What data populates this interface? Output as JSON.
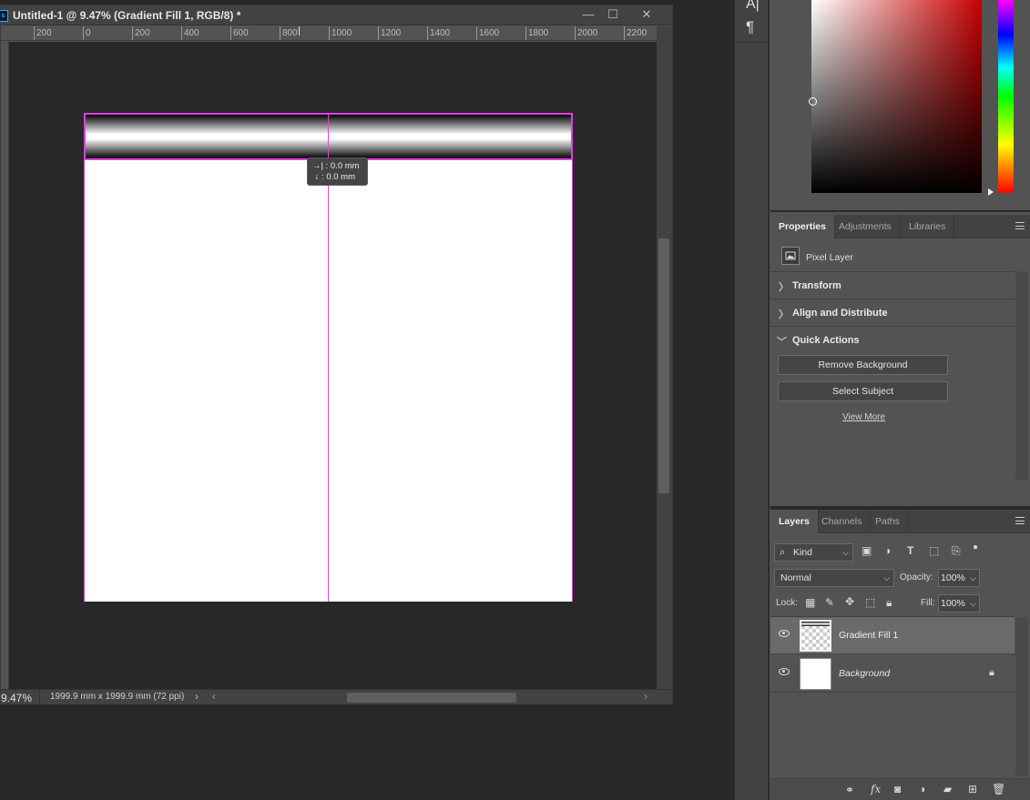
{
  "window": {
    "title": "Untitled-1 @ 9.47% (Gradient Fill 1, RGB/8) *",
    "app_badge": "s",
    "minimize": "—",
    "maximize": "☐",
    "close": "✕"
  },
  "ruler": {
    "top_labels": [
      "200",
      "0",
      "200",
      "400",
      "600",
      "800",
      "1000",
      "1200",
      "1400",
      "1600",
      "1800",
      "2000",
      "2200"
    ]
  },
  "canvas": {
    "tooltip_line1": "0.0 mm",
    "tooltip_line2": "0.0 mm",
    "guide_color": "#d84bd8"
  },
  "status": {
    "zoom": "9.47%",
    "doc_size": "1999.9 mm x 1999.9 mm (72 ppi)",
    "scroll_left": "‹",
    "scroll_right": "›"
  },
  "toolstrip": {
    "char_icon": "A|",
    "para_icon": "¶"
  },
  "properties": {
    "tabs": [
      {
        "label": "Properties",
        "active": true
      },
      {
        "label": "Adjustments",
        "active": false
      },
      {
        "label": "Libraries",
        "active": false
      }
    ],
    "layer_type": "Pixel Layer",
    "sections": {
      "transform": "Transform",
      "align": "Align and Distribute",
      "quick_actions": "Quick Actions"
    },
    "buttons": {
      "remove_bg": "Remove Background",
      "select_subject": "Select Subject",
      "view_more": "View More"
    }
  },
  "layers": {
    "tabs": [
      {
        "label": "Layers",
        "active": true
      },
      {
        "label": "Channels",
        "active": false
      },
      {
        "label": "Paths",
        "active": false
      }
    ],
    "filter_kind": "Kind",
    "blend_mode": "Normal",
    "opacity_label": "Opacity:",
    "opacity_value": "100%",
    "lock_label": "Lock:",
    "fill_label": "Fill:",
    "fill_value": "100%",
    "items": [
      {
        "name": "Gradient Fill 1",
        "selected": true
      },
      {
        "name": "Background",
        "selected": false
      }
    ]
  }
}
